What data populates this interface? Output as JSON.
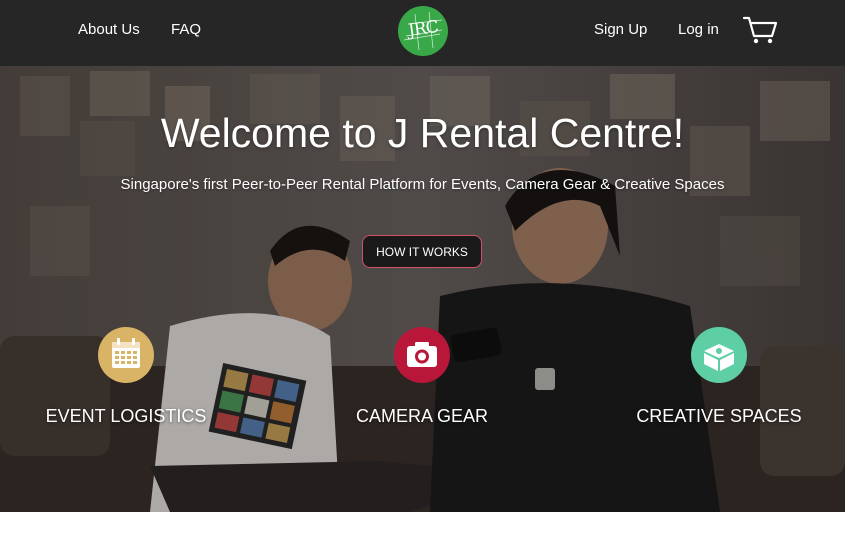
{
  "nav": {
    "about_label": "About Us",
    "faq_label": "FAQ",
    "logo_text": "JRC",
    "signup_label": "Sign Up",
    "login_label": "Log in",
    "cart_icon": "shopping-cart-icon"
  },
  "hero": {
    "title": "Welcome to J Rental Centre!",
    "subtitle": "Singapore's first Peer-to-Peer Rental Platform for Events, Camera Gear & Creative Spaces",
    "cta_label": "HOW IT WORKS"
  },
  "categories": [
    {
      "label": "EVENT LOGISTICS",
      "icon": "calendar-icon",
      "color": "#d9b366"
    },
    {
      "label": "CAMERA GEAR",
      "icon": "camera-icon",
      "color": "#b8173a"
    },
    {
      "label": "CREATIVE SPACES",
      "icon": "open-box-icon",
      "color": "#5ecfa5"
    }
  ],
  "colors": {
    "navbar": "#262626",
    "logo": "#39a849",
    "cta_border": "#d0506a"
  }
}
